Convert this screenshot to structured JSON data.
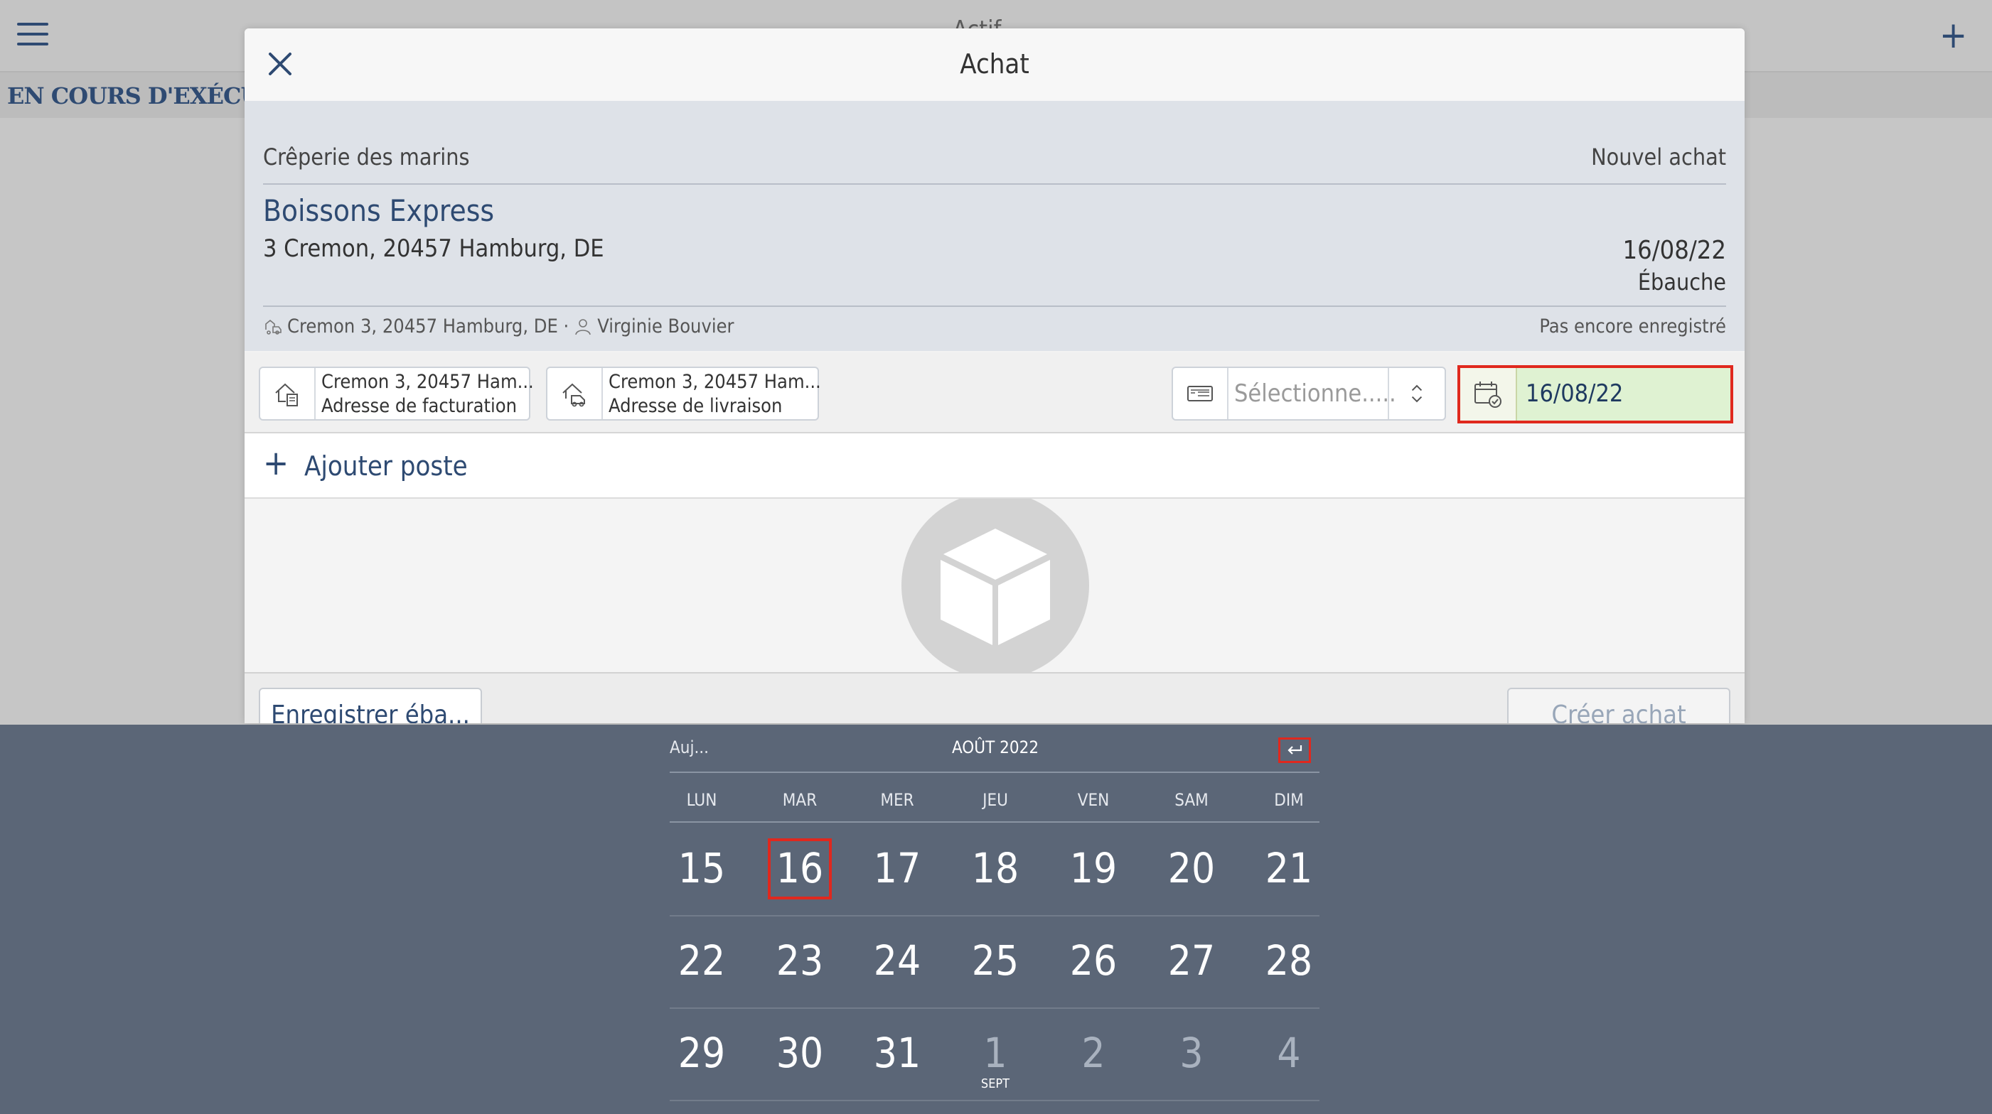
{
  "background": {
    "title": "Actif",
    "section_label": "EN COURS D'EXÉCUTION",
    "add_symbol": "+"
  },
  "modal": {
    "title": "Achat",
    "info": {
      "shop": "Crêperie des marins",
      "new_label": "Nouvel achat",
      "supplier": "Boissons Express",
      "address": "3 Cremon, 20457 Hamburg, DE",
      "date": "16/08/22",
      "status": "Ébauche",
      "meta_address": "Cremon 3, 20457 Hamburg, DE ·",
      "meta_contact": "Virginie Bouvier",
      "registered": "Pas encore enregistré"
    },
    "fields": {
      "billing": {
        "value": "Cremon 3, 20457 Ham...",
        "label": "Adresse de facturation"
      },
      "delivery": {
        "value": "Cremon 3, 20457 Ham...",
        "label": "Adresse de livraison"
      },
      "payment": {
        "placeholder": "Sélectionne....."
      },
      "date": {
        "value": "16/08/22"
      }
    },
    "add_item": {
      "symbol": "+",
      "label": "Ajouter poste"
    },
    "footer": {
      "save_label": "Enregistrer éba...",
      "create_label": "Créer achat"
    }
  },
  "picker": {
    "today_label": "Auj...",
    "month_label": "AOÛT 2022",
    "weekdays": [
      "LUN",
      "MAR",
      "MER",
      "JEU",
      "VEN",
      "SAM",
      "DIM"
    ],
    "weeks": [
      [
        {
          "d": "15"
        },
        {
          "d": "16",
          "selected": true
        },
        {
          "d": "17"
        },
        {
          "d": "18"
        },
        {
          "d": "19"
        },
        {
          "d": "20"
        },
        {
          "d": "21"
        }
      ],
      [
        {
          "d": "22"
        },
        {
          "d": "23"
        },
        {
          "d": "24"
        },
        {
          "d": "25"
        },
        {
          "d": "26"
        },
        {
          "d": "27"
        },
        {
          "d": "28"
        }
      ],
      [
        {
          "d": "29"
        },
        {
          "d": "30"
        },
        {
          "d": "31"
        },
        {
          "d": "1",
          "muted": true,
          "sub": "SEPT"
        },
        {
          "d": "2",
          "muted": true
        },
        {
          "d": "3",
          "muted": true
        },
        {
          "d": "4",
          "muted": true
        }
      ]
    ],
    "accent_color": "#e0281e"
  }
}
